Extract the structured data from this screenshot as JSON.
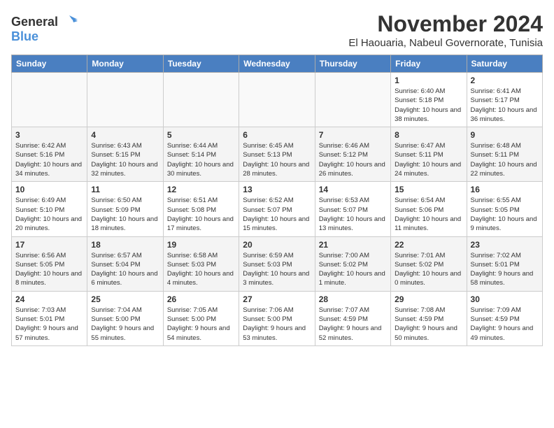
{
  "logo": {
    "general": "General",
    "blue": "Blue"
  },
  "title": "November 2024",
  "location": "El Haouaria, Nabeul Governorate, Tunisia",
  "weekdays": [
    "Sunday",
    "Monday",
    "Tuesday",
    "Wednesday",
    "Thursday",
    "Friday",
    "Saturday"
  ],
  "weeks": [
    [
      {
        "day": "",
        "detail": ""
      },
      {
        "day": "",
        "detail": ""
      },
      {
        "day": "",
        "detail": ""
      },
      {
        "day": "",
        "detail": ""
      },
      {
        "day": "",
        "detail": ""
      },
      {
        "day": "1",
        "detail": "Sunrise: 6:40 AM\nSunset: 5:18 PM\nDaylight: 10 hours and 38 minutes."
      },
      {
        "day": "2",
        "detail": "Sunrise: 6:41 AM\nSunset: 5:17 PM\nDaylight: 10 hours and 36 minutes."
      }
    ],
    [
      {
        "day": "3",
        "detail": "Sunrise: 6:42 AM\nSunset: 5:16 PM\nDaylight: 10 hours and 34 minutes."
      },
      {
        "day": "4",
        "detail": "Sunrise: 6:43 AM\nSunset: 5:15 PM\nDaylight: 10 hours and 32 minutes."
      },
      {
        "day": "5",
        "detail": "Sunrise: 6:44 AM\nSunset: 5:14 PM\nDaylight: 10 hours and 30 minutes."
      },
      {
        "day": "6",
        "detail": "Sunrise: 6:45 AM\nSunset: 5:13 PM\nDaylight: 10 hours and 28 minutes."
      },
      {
        "day": "7",
        "detail": "Sunrise: 6:46 AM\nSunset: 5:12 PM\nDaylight: 10 hours and 26 minutes."
      },
      {
        "day": "8",
        "detail": "Sunrise: 6:47 AM\nSunset: 5:11 PM\nDaylight: 10 hours and 24 minutes."
      },
      {
        "day": "9",
        "detail": "Sunrise: 6:48 AM\nSunset: 5:11 PM\nDaylight: 10 hours and 22 minutes."
      }
    ],
    [
      {
        "day": "10",
        "detail": "Sunrise: 6:49 AM\nSunset: 5:10 PM\nDaylight: 10 hours and 20 minutes."
      },
      {
        "day": "11",
        "detail": "Sunrise: 6:50 AM\nSunset: 5:09 PM\nDaylight: 10 hours and 18 minutes."
      },
      {
        "day": "12",
        "detail": "Sunrise: 6:51 AM\nSunset: 5:08 PM\nDaylight: 10 hours and 17 minutes."
      },
      {
        "day": "13",
        "detail": "Sunrise: 6:52 AM\nSunset: 5:07 PM\nDaylight: 10 hours and 15 minutes."
      },
      {
        "day": "14",
        "detail": "Sunrise: 6:53 AM\nSunset: 5:07 PM\nDaylight: 10 hours and 13 minutes."
      },
      {
        "day": "15",
        "detail": "Sunrise: 6:54 AM\nSunset: 5:06 PM\nDaylight: 10 hours and 11 minutes."
      },
      {
        "day": "16",
        "detail": "Sunrise: 6:55 AM\nSunset: 5:05 PM\nDaylight: 10 hours and 9 minutes."
      }
    ],
    [
      {
        "day": "17",
        "detail": "Sunrise: 6:56 AM\nSunset: 5:05 PM\nDaylight: 10 hours and 8 minutes."
      },
      {
        "day": "18",
        "detail": "Sunrise: 6:57 AM\nSunset: 5:04 PM\nDaylight: 10 hours and 6 minutes."
      },
      {
        "day": "19",
        "detail": "Sunrise: 6:58 AM\nSunset: 5:03 PM\nDaylight: 10 hours and 4 minutes."
      },
      {
        "day": "20",
        "detail": "Sunrise: 6:59 AM\nSunset: 5:03 PM\nDaylight: 10 hours and 3 minutes."
      },
      {
        "day": "21",
        "detail": "Sunrise: 7:00 AM\nSunset: 5:02 PM\nDaylight: 10 hours and 1 minute."
      },
      {
        "day": "22",
        "detail": "Sunrise: 7:01 AM\nSunset: 5:02 PM\nDaylight: 10 hours and 0 minutes."
      },
      {
        "day": "23",
        "detail": "Sunrise: 7:02 AM\nSunset: 5:01 PM\nDaylight: 9 hours and 58 minutes."
      }
    ],
    [
      {
        "day": "24",
        "detail": "Sunrise: 7:03 AM\nSunset: 5:01 PM\nDaylight: 9 hours and 57 minutes."
      },
      {
        "day": "25",
        "detail": "Sunrise: 7:04 AM\nSunset: 5:00 PM\nDaylight: 9 hours and 55 minutes."
      },
      {
        "day": "26",
        "detail": "Sunrise: 7:05 AM\nSunset: 5:00 PM\nDaylight: 9 hours and 54 minutes."
      },
      {
        "day": "27",
        "detail": "Sunrise: 7:06 AM\nSunset: 5:00 PM\nDaylight: 9 hours and 53 minutes."
      },
      {
        "day": "28",
        "detail": "Sunrise: 7:07 AM\nSunset: 4:59 PM\nDaylight: 9 hours and 52 minutes."
      },
      {
        "day": "29",
        "detail": "Sunrise: 7:08 AM\nSunset: 4:59 PM\nDaylight: 9 hours and 50 minutes."
      },
      {
        "day": "30",
        "detail": "Sunrise: 7:09 AM\nSunset: 4:59 PM\nDaylight: 9 hours and 49 minutes."
      }
    ]
  ]
}
